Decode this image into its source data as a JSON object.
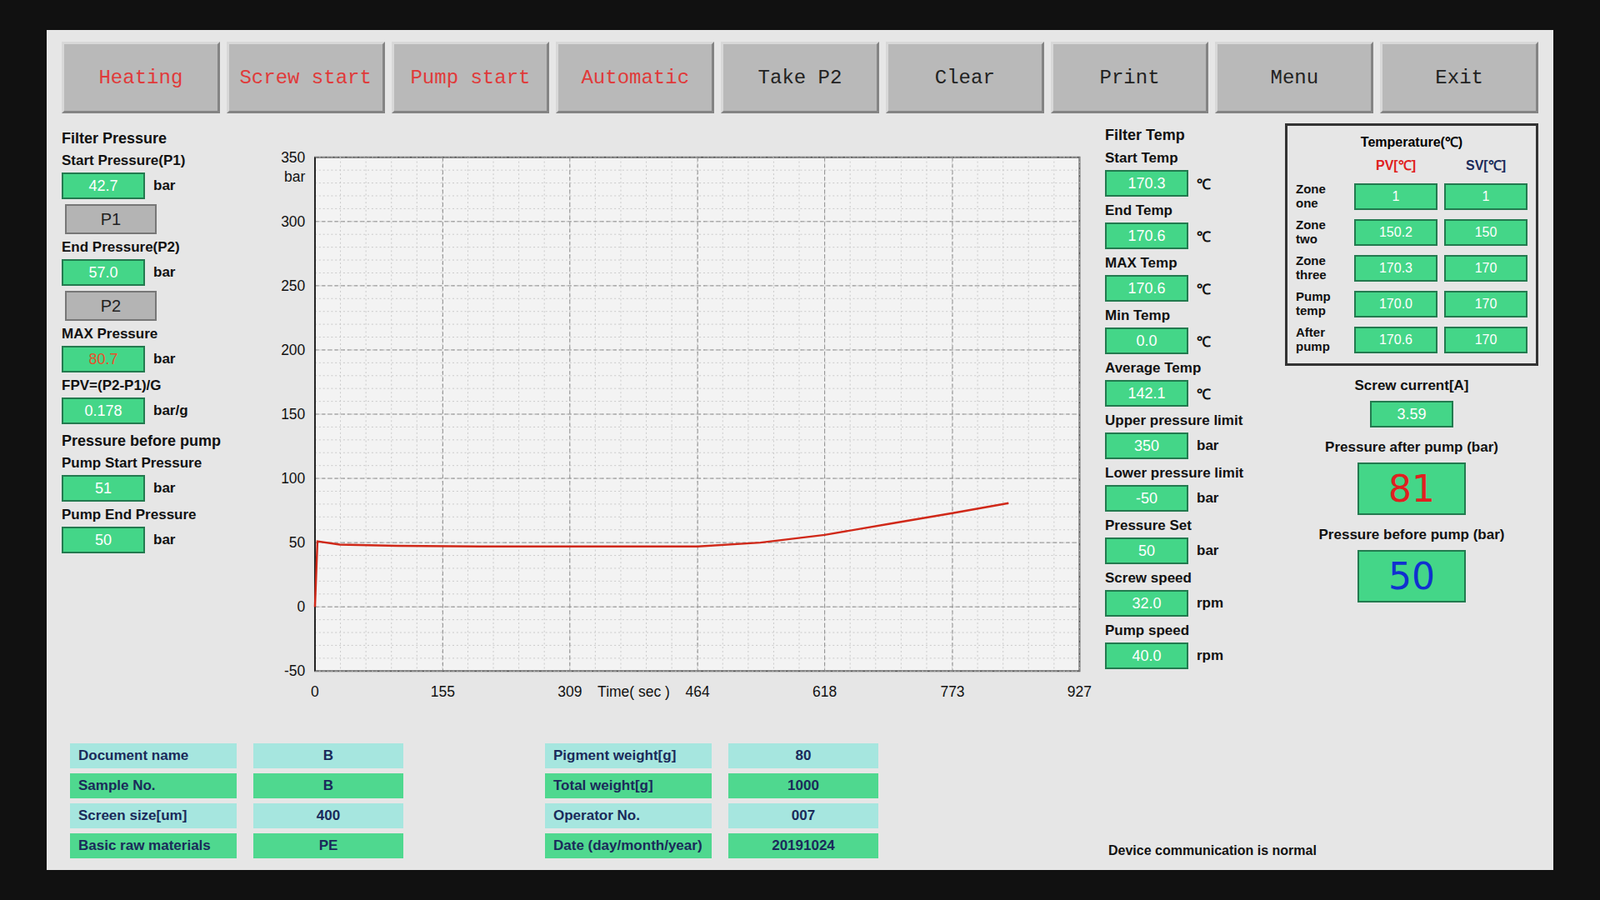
{
  "toolbar": [
    {
      "label": "Heating",
      "color": "#e03a3a"
    },
    {
      "label": "Screw start",
      "color": "#e03a3a"
    },
    {
      "label": "Pump start",
      "color": "#e03a3a"
    },
    {
      "label": "Automatic",
      "color": "#e03a3a"
    },
    {
      "label": "Take P2",
      "color": "#222222"
    },
    {
      "label": "Clear",
      "color": "#222222"
    },
    {
      "label": "Print",
      "color": "#222222"
    },
    {
      "label": "Menu",
      "color": "#222222"
    },
    {
      "label": "Exit",
      "color": "#222222"
    }
  ],
  "left_panel": [
    {
      "kind": "heading",
      "label": "Filter Pressure"
    },
    {
      "kind": "field",
      "label": "Start Pressure(P1)",
      "value": "42.7",
      "unit": "bar",
      "color": "#ffffff"
    },
    {
      "kind": "button",
      "label": "P1"
    },
    {
      "kind": "field",
      "label": "End Pressure(P2)",
      "value": "57.0",
      "unit": "bar",
      "color": "#ffffff"
    },
    {
      "kind": "button",
      "label": "P2"
    },
    {
      "kind": "field",
      "label": "MAX Pressure",
      "value": "80.7",
      "unit": "bar",
      "color": "#e8502a"
    },
    {
      "kind": "field",
      "label": "FPV=(P2-P1)/G",
      "value": "0.178",
      "unit": "bar/g",
      "color": "#ffffff"
    },
    {
      "kind": "heading",
      "label": "Pressure before pump"
    },
    {
      "kind": "field",
      "label": "Pump Start Pressure",
      "value": "51",
      "unit": "bar",
      "color": "#ffffff"
    },
    {
      "kind": "field",
      "label": "Pump End Pressure",
      "value": "50",
      "unit": "bar",
      "color": "#ffffff"
    }
  ],
  "chart": {
    "y_unit": "bar",
    "y_ticks": [
      "350",
      "300",
      "250",
      "200",
      "150",
      "100",
      "50",
      "0",
      "-50"
    ],
    "x_ticks": [
      "0",
      "155",
      "309",
      "464",
      "618",
      "773",
      "927"
    ],
    "x_label": "Time( sec )",
    "series": [
      {
        "color": "#d02818",
        "points": [
          [
            0,
            0
          ],
          [
            3,
            51
          ],
          [
            30,
            48.5
          ],
          [
            100,
            47.5
          ],
          [
            200,
            47
          ],
          [
            300,
            47
          ],
          [
            400,
            47
          ],
          [
            464,
            47
          ],
          [
            540,
            50
          ],
          [
            618,
            56
          ],
          [
            700,
            65
          ],
          [
            773,
            73
          ],
          [
            841,
            80.7
          ]
        ]
      }
    ]
  },
  "right_panel": [
    {
      "kind": "heading",
      "label": "Filter Temp"
    },
    {
      "kind": "field",
      "label": "Start Temp",
      "value": "170.3",
      "unit": "℃"
    },
    {
      "kind": "field",
      "label": "End Temp",
      "value": "170.6",
      "unit": "℃"
    },
    {
      "kind": "field",
      "label": "MAX Temp",
      "value": "170.6",
      "unit": "℃"
    },
    {
      "kind": "field",
      "label": "Min Temp",
      "value": "0.0",
      "unit": "℃"
    },
    {
      "kind": "field",
      "label": "Average Temp",
      "value": "142.1",
      "unit": "℃"
    },
    {
      "kind": "field",
      "label": "Upper pressure limit",
      "value": "350",
      "unit": "bar"
    },
    {
      "kind": "field",
      "label": "Lower pressure limit",
      "value": "-50",
      "unit": "bar"
    },
    {
      "kind": "field",
      "label": "Pressure Set",
      "value": "50",
      "unit": "bar"
    },
    {
      "kind": "field",
      "label": "Screw speed",
      "value": "32.0",
      "unit": "rpm"
    },
    {
      "kind": "field",
      "label": "Pump speed",
      "value": "40.0",
      "unit": "rpm"
    }
  ],
  "temperature_table": {
    "title": "Temperature(℃)",
    "columns": [
      {
        "label": "PV[℃]",
        "color": "#e02020"
      },
      {
        "label": "SV[℃]",
        "color": "#1a2a5a"
      }
    ],
    "rows": [
      {
        "label": "Zone one",
        "pv": "1",
        "sv": "1"
      },
      {
        "label": "Zone two",
        "pv": "150.2",
        "sv": "150"
      },
      {
        "label": "Zone three",
        "pv": "170.3",
        "sv": "170"
      },
      {
        "label": "Pump temp",
        "pv": "170.0",
        "sv": "170"
      },
      {
        "label": "After pump",
        "pv": "170.6",
        "sv": "170"
      }
    ]
  },
  "screw_current": {
    "label": "Screw current[A]",
    "value": "3.59"
  },
  "big_readings": [
    {
      "label": "Pressure after pump (bar)",
      "value": "81",
      "color": "#e02020"
    },
    {
      "label": "Pressure before pump (bar)",
      "value": "50",
      "color": "#1030d0"
    }
  ],
  "status": "Device communication is normal",
  "info": {
    "left": [
      {
        "label": "Document name",
        "value": "B"
      },
      {
        "label": "Sample No.",
        "value": "B"
      },
      {
        "label": "Screen size[um]",
        "value": "400"
      },
      {
        "label": "Basic raw materials",
        "value": "PE"
      }
    ],
    "right": [
      {
        "label": "Pigment weight[g]",
        "value": "80"
      },
      {
        "label": "Total weight[g]",
        "value": "1000"
      },
      {
        "label": "Operator No.",
        "value": "007"
      },
      {
        "label": "Date (day/month/year)",
        "value": "20191024"
      }
    ]
  }
}
